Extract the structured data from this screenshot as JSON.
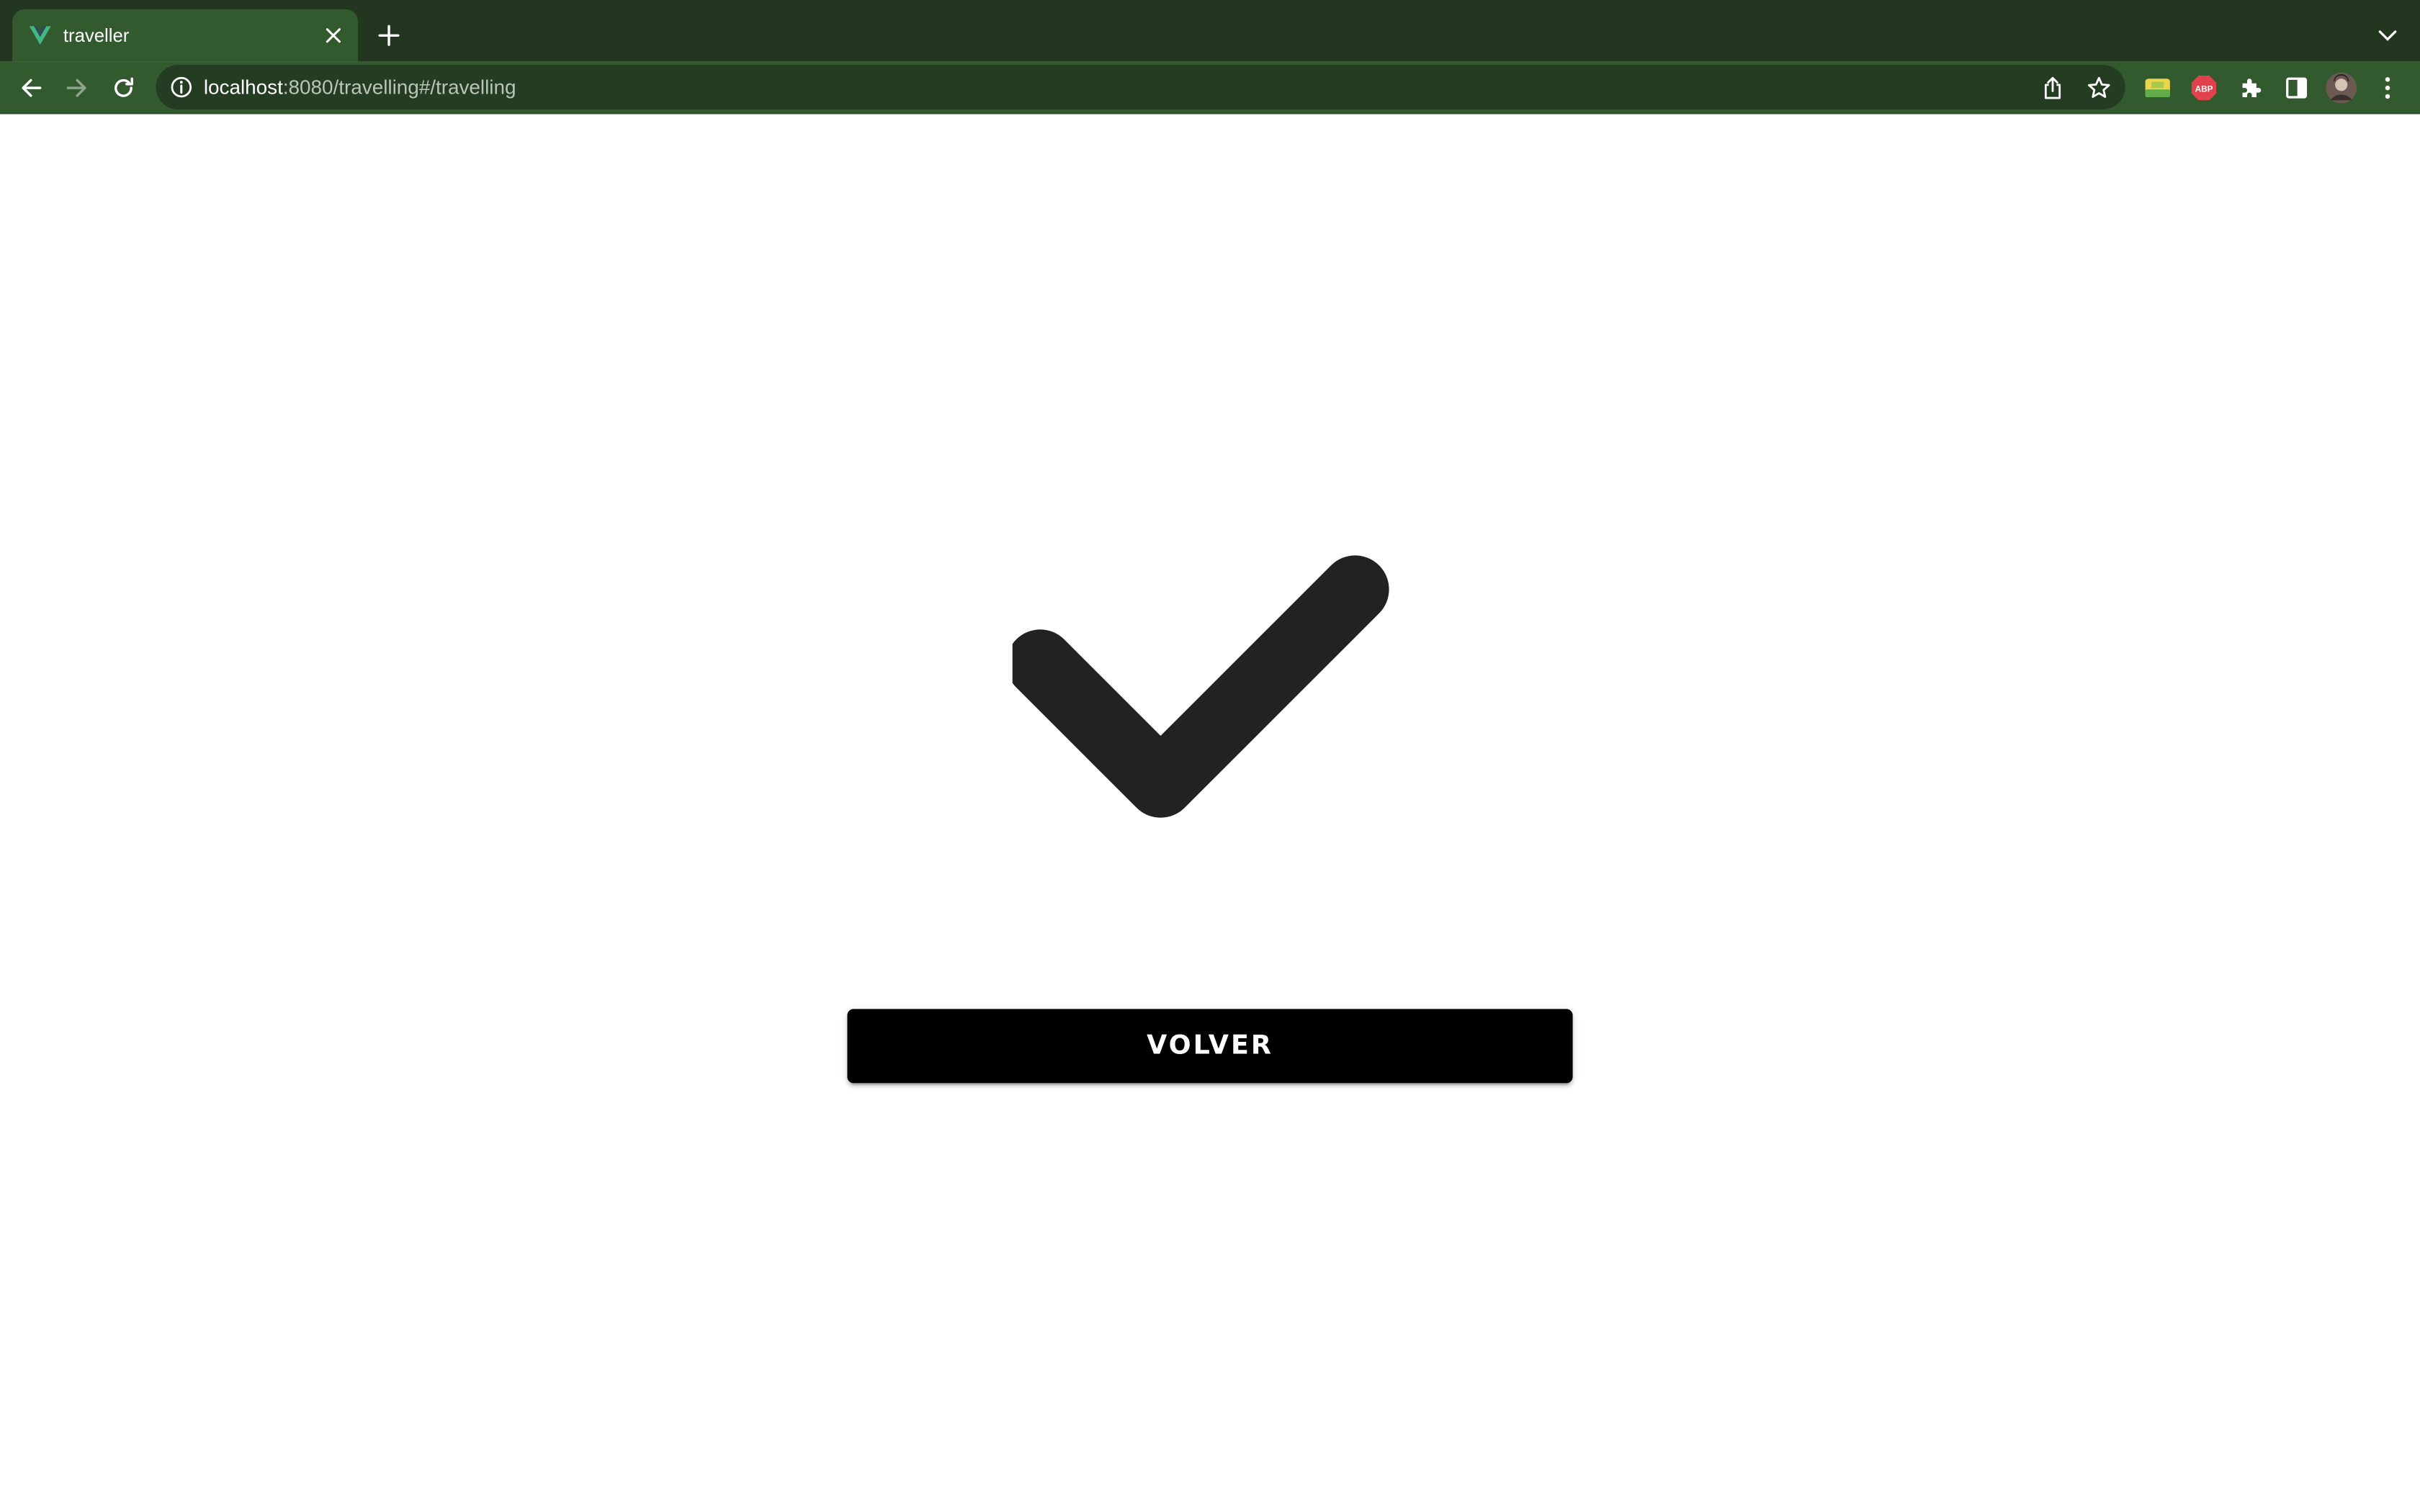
{
  "browser": {
    "tab": {
      "title": "traveller",
      "favicon": "vue-logo-icon"
    },
    "address_bar": {
      "host": "localhost",
      "path": ":8080/travelling#/travelling"
    },
    "colors": {
      "tabstrip": "#223620",
      "toolbar": "#335a2e",
      "omnibox": "#243d22"
    }
  },
  "page": {
    "icon": "checkmark-icon",
    "icon_color": "#222222",
    "button_label": "VOLVER",
    "button_color": "#000000"
  }
}
